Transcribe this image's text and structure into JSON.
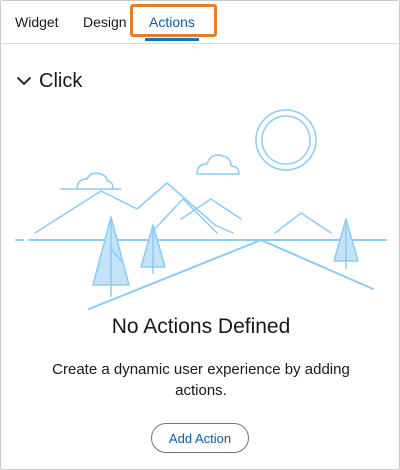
{
  "tabs": [
    {
      "label": "Widget"
    },
    {
      "label": "Design"
    },
    {
      "label": "Actions",
      "active": true
    }
  ],
  "section": {
    "title": "Click",
    "expanded": true
  },
  "empty_state": {
    "title": "No Actions Defined",
    "description": "Create a dynamic user experience by adding actions.",
    "button_label": "Add Action"
  },
  "colors": {
    "accent": "#0176d3",
    "highlight": "#e37f2c",
    "illustration_line": "#8ccbf2",
    "illustration_fill": "#c2e3f8"
  }
}
